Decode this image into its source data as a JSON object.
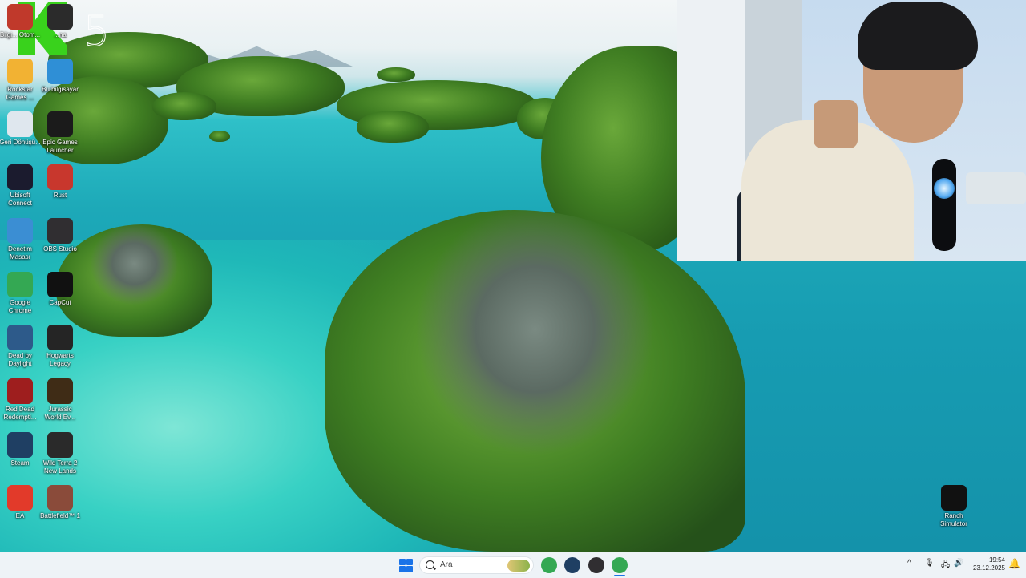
{
  "brand": {
    "corner_number": "5",
    "accent_color": "#39d21c"
  },
  "desktop": {
    "left_icons": [
      {
        "name": "bilgisayar-otom",
        "label": "Bilgi... Otom...",
        "icon": "app-red-icon",
        "color": "#c0392b"
      },
      {
        "name": "hesap",
        "label": "...na",
        "icon": "app-dark-icon",
        "color": "#2b2b2b"
      },
      {
        "name": "rockstar",
        "label": "Rockstar Games ...",
        "icon": "rockstar-icon",
        "color": "#f2b233"
      },
      {
        "name": "bu-bilgisayar",
        "label": "Bu bilgisayar",
        "icon": "monitor-icon",
        "color": "#2f8fd6"
      },
      {
        "name": "geri-donusum",
        "label": "Geri Dönüşü...",
        "icon": "recycle-bin-icon",
        "color": "#dfe7ee"
      },
      {
        "name": "epic",
        "label": "Epic Games Launcher",
        "icon": "epic-games-icon",
        "color": "#1b1b1b"
      },
      {
        "name": "ubisoft",
        "label": "Ubisoft Connect",
        "icon": "ubisoft-icon",
        "color": "#1b1b2e"
      },
      {
        "name": "rust",
        "label": "Rust",
        "icon": "rust-icon",
        "color": "#c8372d"
      },
      {
        "name": "denetim",
        "label": "Denetim Masası",
        "icon": "control-panel-icon",
        "color": "#3b8ed3"
      },
      {
        "name": "obs",
        "label": "OBS Studio",
        "icon": "obs-icon",
        "color": "#302e31"
      },
      {
        "name": "chrome",
        "label": "Google Chrome",
        "icon": "chrome-icon",
        "color": "#34a853"
      },
      {
        "name": "capcut",
        "label": "CapCut",
        "icon": "capcut-icon",
        "color": "#111111"
      },
      {
        "name": "dbd",
        "label": "Dead by Daylight",
        "icon": "dbd-icon",
        "color": "#2d5a8a"
      },
      {
        "name": "hogwarts",
        "label": "Hogwarts Legacy",
        "icon": "hogwarts-icon",
        "color": "#252525"
      },
      {
        "name": "rdr",
        "label": "Red Dead Redempti...",
        "icon": "rdr-icon",
        "color": "#9e1e1e"
      },
      {
        "name": "jurassic",
        "label": "Jurassic World Ev...",
        "icon": "jurassic-icon",
        "color": "#3f2c16"
      },
      {
        "name": "steam",
        "label": "Steam",
        "icon": "steam-icon",
        "color": "#1f3f63"
      },
      {
        "name": "wildterra",
        "label": "Wild Terra 2 New Lands",
        "icon": "wild-terra-icon",
        "color": "#2a2a2a"
      },
      {
        "name": "ea",
        "label": "EA",
        "icon": "ea-icon",
        "color": "#e23a2a"
      },
      {
        "name": "battlefield",
        "label": "Battlefield™ 1",
        "icon": "battlefield-icon",
        "color": "#8a4b3a"
      }
    ],
    "right_icons": [
      {
        "name": "ranch",
        "label": "Ranch Simulator",
        "icon": "ranch-simulator-icon",
        "color": "#111111"
      }
    ]
  },
  "taskbar": {
    "search_placeholder": "Ara",
    "apps": [
      {
        "name": "chrome",
        "icon": "chrome-icon",
        "color": "#34a853"
      },
      {
        "name": "steam",
        "icon": "steam-icon",
        "color": "#1f3f63"
      },
      {
        "name": "obs",
        "icon": "obs-icon",
        "color": "#302e31"
      },
      {
        "name": "chrome-active",
        "icon": "chrome-icon",
        "color": "#34a853"
      }
    ],
    "tray": {
      "chevron": "^",
      "mic": "🎙",
      "network": "🖧",
      "volume": "🔊"
    },
    "clock": {
      "time": "19:54",
      "date": "23.12.2025"
    }
  }
}
